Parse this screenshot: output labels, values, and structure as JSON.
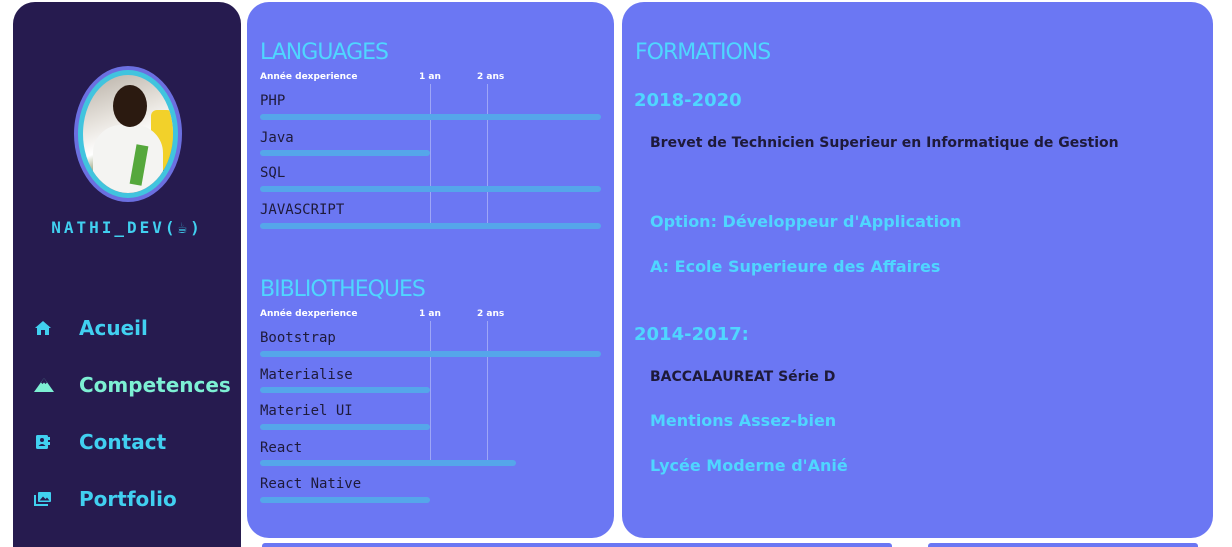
{
  "sidebar": {
    "username": "NATHI_DEV(☕)",
    "nav": [
      {
        "label": "Acueil",
        "icon": "home-icon"
      },
      {
        "label": "Competences",
        "icon": "mountain-icon"
      },
      {
        "label": "Contact",
        "icon": "contact-book-icon"
      },
      {
        "label": "Portfolio",
        "icon": "image-gallery-icon"
      }
    ]
  },
  "languages": {
    "title": "LANGUAGES",
    "scale_label": "Année dexperience",
    "scale_1": "1 an",
    "scale_2": "2 ans",
    "items": [
      {
        "name": "PHP",
        "years": 3
      },
      {
        "name": "Java",
        "years": 1
      },
      {
        "name": "SQL",
        "years": 3
      },
      {
        "name": "JAVASCRIPT",
        "years": 3
      }
    ]
  },
  "libraries": {
    "title": "BIBLIOTHEQUES",
    "scale_label": "Année dexperience",
    "scale_1": "1 an",
    "scale_2": "2 ans",
    "items": [
      {
        "name": "Bootstrap",
        "years": 3
      },
      {
        "name": "Materialise",
        "years": 1
      },
      {
        "name": "Materiel UI",
        "years": 1
      },
      {
        "name": "React",
        "years": 1.5
      },
      {
        "name": "React Native",
        "years": 1
      }
    ]
  },
  "formations": {
    "title": "FORMATIONS",
    "entries": [
      {
        "years": "2018-2020",
        "degree": "Brevet de Technicien Superieur en Informatique de Gestion",
        "details": [
          "Option: Développeur d'Application",
          "A: Ecole Superieure des Affaires"
        ]
      },
      {
        "years": "2014-2017:",
        "degree": "BACCALAUREAT Série D",
        "details": [
          "Mentions Assez-bien",
          "Lycée Moderne d'Anié"
        ]
      }
    ]
  },
  "colors": {
    "sidebar_bg": "#261b4f",
    "panel_bg": "#6b77f3",
    "accent_cyan": "#41d0f0",
    "bar": "#55a6ea"
  }
}
